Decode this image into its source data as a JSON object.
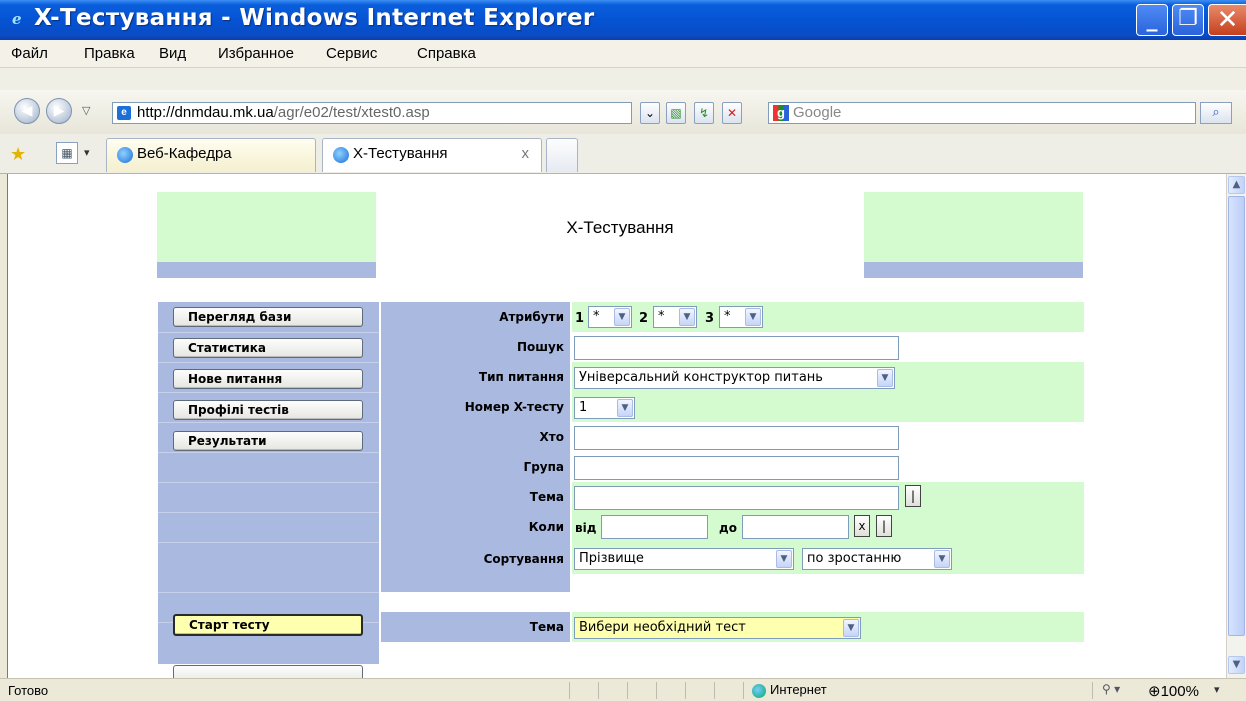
{
  "window": {
    "title": "X-Тестування - Windows Internet Explorer",
    "controls": {
      "minimize": "_",
      "maximize": "❐",
      "close": "✕"
    }
  },
  "menu": [
    "Файл",
    "Правка",
    "Вид",
    "Избранное",
    "Сервис",
    "Справка"
  ],
  "address": {
    "host": "http://dnmdau.mk.ua",
    "path": "/agr/e02/test/xtest0.asp"
  },
  "search": {
    "placeholder": "Google"
  },
  "tabs": [
    {
      "label": "Веб-Кафедра"
    },
    {
      "label": "X-Тестування",
      "close": "x"
    }
  ],
  "page": {
    "title": "X-Тестування",
    "nav_buttons": [
      "Перегляд бази",
      "Статистика",
      "Нове питання",
      "Профілі тестів",
      "Результати"
    ],
    "start_button": "Старт тесту",
    "form": {
      "attributes_label": "Атрибути",
      "attributes": [
        {
          "num": "1",
          "value": "*"
        },
        {
          "num": "2",
          "value": "*"
        },
        {
          "num": "3",
          "value": "*"
        }
      ],
      "search_label": "Пошук",
      "search_value": "",
      "qtype_label": "Тип питання",
      "qtype_value": "Універсальний конструктор питань",
      "xtest_label": "Номер X-тесту",
      "xtest_value": "1",
      "who_label": "Хто",
      "who_value": "",
      "group_label": "Група",
      "group_value": "",
      "topic_label": "Тема",
      "topic_value": "",
      "topic_btn": "|",
      "when_label": "Коли",
      "from_label": "від",
      "from_value": "",
      "to_label": "до",
      "to_value": "",
      "clear_btn": "x",
      "when_btn": "|",
      "sort_label": "Сортування",
      "sort_value": "Прізвище",
      "sort_order": "по зростанню",
      "test_topic_label": "Тема",
      "test_topic_value": "Вибери необхідний тест"
    }
  },
  "status": {
    "text": "Готово",
    "zone": "Интернет",
    "zoom": "100%"
  },
  "colors": {
    "green": "#d4fbcf",
    "blue_band": "#aab9e0",
    "start_button": "#ffffb0",
    "titlebar": "#0553d4"
  }
}
